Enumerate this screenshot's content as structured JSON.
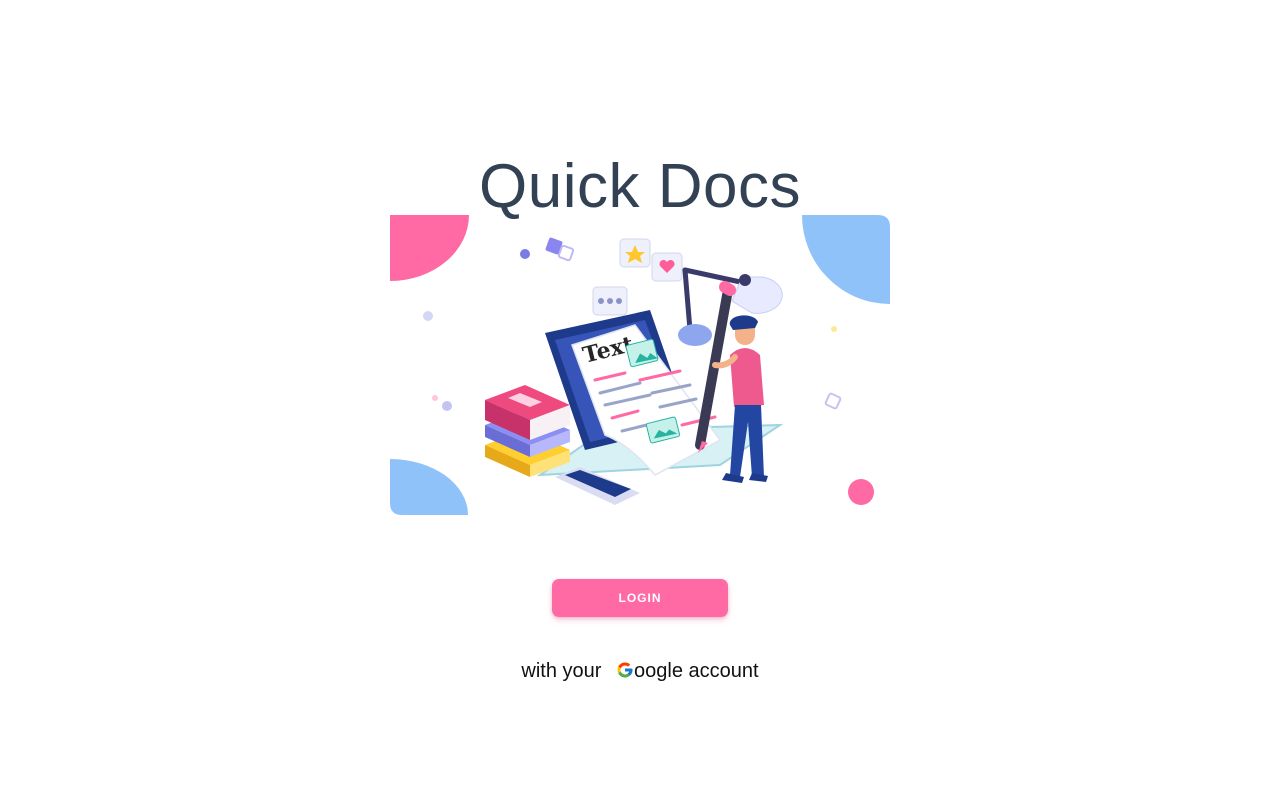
{
  "app": {
    "title": "Quick Docs"
  },
  "illustration": {
    "doc_text": "Text"
  },
  "login": {
    "label": "LOGIN"
  },
  "subline": {
    "prefix": "with your",
    "brand_rest": "oogle",
    "suffix": "account"
  },
  "colors": {
    "accent_pink": "#ff6aa5",
    "accent_blue": "#90c2fa",
    "title": "#334155"
  },
  "icons": [
    "google-g-icon"
  ]
}
